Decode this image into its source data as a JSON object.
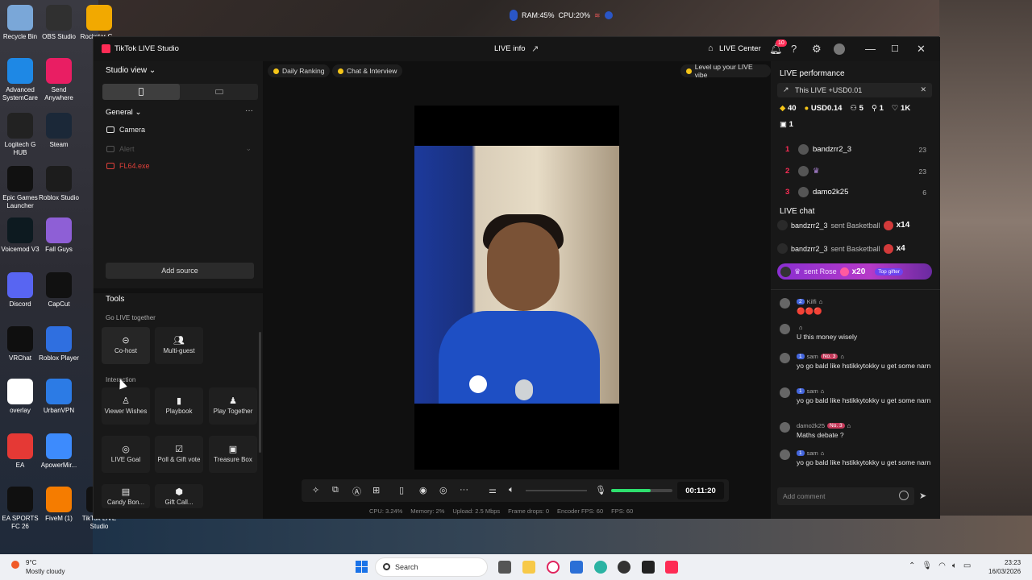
{
  "system_monitor": {
    "ram": "RAM:45%",
    "cpu": "CPU:20%"
  },
  "desktop_icons": [
    {
      "label": "Recycle Bin",
      "color": "#7aa7d8"
    },
    {
      "label": "OBS Studio",
      "color": "#303030"
    },
    {
      "label": "Rockstar G...",
      "color": "#f2a900"
    },
    {
      "label": "Advanced SystemCare",
      "color": "#1e88e5"
    },
    {
      "label": "Send Anywhere",
      "color": "#e91e63"
    },
    {
      "label": "Logitech G HUB",
      "color": "#222222"
    },
    {
      "label": "Steam",
      "color": "#1b2838"
    },
    {
      "label": "Epic Games Launcher",
      "color": "#111111"
    },
    {
      "label": "Roblox Studio",
      "color": "#1c1c1c"
    },
    {
      "label": "Voicemod V3",
      "color": "#0d1a20"
    },
    {
      "label": "Fall Guys",
      "color": "#8e5fd6"
    },
    {
      "label": "Discord",
      "color": "#5865f2"
    },
    {
      "label": "CapCut",
      "color": "#111111"
    },
    {
      "label": "VRChat",
      "color": "#0f0f0f"
    },
    {
      "label": "Roblox Player",
      "color": "#2f6fe0"
    },
    {
      "label": "overlay",
      "color": "#ffffff"
    },
    {
      "label": "UrbanVPN",
      "color": "#2c7be5"
    },
    {
      "label": "EA",
      "color": "#e53935"
    },
    {
      "label": "ApowerMir...",
      "color": "#3d8bfd"
    },
    {
      "label": "EA SPORTS FC 26",
      "color": "#101010"
    },
    {
      "label": "FiveM (1)",
      "color": "#f57c00"
    },
    {
      "label": "TikTok LIVE Studio",
      "color": "#111111"
    }
  ],
  "titlebar": {
    "app_name": "TikTok LIVE Studio",
    "live_info": "LIVE info",
    "live_center": "LIVE Center",
    "notif_count": "10"
  },
  "left": {
    "studio_view": "Studio view",
    "general": "General",
    "sources": [
      {
        "label": "Camera",
        "state": "active"
      },
      {
        "label": "Alert",
        "state": "disabled"
      },
      {
        "label": "FL64.exe",
        "state": "error"
      }
    ],
    "add_source": "Add source",
    "tools_title": "Tools",
    "go_live_together": "Go LIVE together",
    "interaction": "Interaction",
    "tools_live_together": [
      "Co-host",
      "Multi-guest"
    ],
    "tools_interaction": [
      "Viewer Wishes",
      "Playbook",
      "Play Together",
      "LIVE Goal",
      "Poll & Gift vote",
      "Treasure Box",
      "Candy Bon...",
      "Gift Call..."
    ]
  },
  "center": {
    "pill_daily": "Daily Ranking",
    "pill_chat": "Chat & Interview",
    "pill_levelup": "Level up your LIVE vibe",
    "timer": "00:11:20",
    "mic_level": 0.65,
    "stats": [
      "CPU: 3.24%",
      "Memory: 2%",
      "Upload: 2.5 Mbps",
      "Frame drops: 0",
      "Encoder FPS: 60",
      "FPS: 60"
    ]
  },
  "right": {
    "perf_title": "LIVE performance",
    "this_live": "This LIVE +USD0.01",
    "metrics": [
      "40",
      "USD0.14",
      "5",
      "1",
      "1K"
    ],
    "metric_sub": "1",
    "ranking": [
      {
        "rank": "1",
        "name": "bandzrr2_3",
        "score": "23"
      },
      {
        "rank": "2",
        "name": "",
        "score": "23"
      },
      {
        "rank": "3",
        "name": "damo2k25",
        "score": "6"
      }
    ],
    "chat_title": "LIVE chat",
    "gifts": [
      {
        "name": "bandzrr2_3",
        "action": "sent Basketball",
        "count": "x14"
      },
      {
        "name": "bandzrr2_3",
        "action": "sent Basketball",
        "count": "x4"
      }
    ],
    "rose": {
      "action": "sent Rose",
      "count": "x20",
      "tag": "Top gifter"
    },
    "messages": [
      {
        "level": "2",
        "user": "Kilfi",
        "rank": "",
        "text": "🔴🔴🔴"
      },
      {
        "level": "",
        "user": "",
        "rank": "",
        "text": "U this money wisely"
      },
      {
        "level": "1",
        "user": "sam",
        "rank": "No. 3",
        "text": "yo go bald like hstikkytokky u get some narn"
      },
      {
        "level": "1",
        "user": "sam",
        "rank": "",
        "text": "yo go bald like hstikkytokky u get some narn"
      },
      {
        "level": "",
        "user": "damo2k25",
        "rank": "No. 3",
        "text": "Maths debate ?"
      },
      {
        "level": "1",
        "user": "sam",
        "rank": "",
        "text": "yo go bald like hstikkytokky u get some narn"
      }
    ],
    "comment_placeholder": "Add comment"
  },
  "taskbar": {
    "temp": "9°C",
    "condition": "Mostly cloudy",
    "search": "Search",
    "time": "23:23",
    "date": "16/03/2026"
  }
}
